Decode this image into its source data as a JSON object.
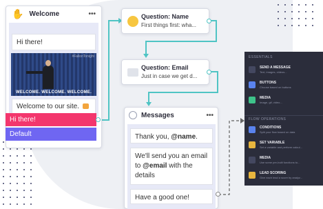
{
  "welcome": {
    "title": "Welcome",
    "menu": "•••",
    "messages": [
      "Hi there!",
      "Welcome to our site."
    ],
    "gif_caption": "WELCOME. WELCOME. WELCOME.",
    "gif_brand": "#FallonTonight",
    "choices": [
      "Hi there!",
      "Default"
    ]
  },
  "question_name": {
    "title": "Question: Name",
    "subtitle": "First things first: wha..."
  },
  "question_email": {
    "title": "Question: Email",
    "subtitle": "Just in case we get d..."
  },
  "messages_node": {
    "title": "Messages",
    "menu": "•••",
    "m1_pre": "Thank you, ",
    "m1_var": "@name",
    "m1_post": ".",
    "m2_pre": "We'll send you an email to ",
    "m2_var": "@email",
    "m2_post": " with the details",
    "m3": "Have a good one!"
  },
  "panel": {
    "section1": "ESSENTIALS",
    "section2": "FLOW OPERATIONS",
    "items1": [
      {
        "label": "SEND A MESSAGE",
        "desc": "Text, images, videos..."
      },
      {
        "label": "BUTTONS",
        "desc": "Choose based on buttons"
      },
      {
        "label": "MEDIA",
        "desc": "Image, gif, video..."
      }
    ],
    "items2": [
      {
        "label": "CONDITIONS",
        "desc": "Split your flow based on data"
      },
      {
        "label": "SET VARIABLE",
        "desc": "Set a variable and perform calcul..."
      },
      {
        "label": "MEDIA",
        "desc": "Use some pre-built functions to..."
      },
      {
        "label": "LEAD SCORING",
        "desc": "Give each lead a score by analyz..."
      }
    ]
  },
  "colors": {
    "connector": "#4fc4c4",
    "choice_primary": "#f3366d",
    "choice_default": "#6f66f2",
    "panel_bg": "#2b2d3b"
  }
}
